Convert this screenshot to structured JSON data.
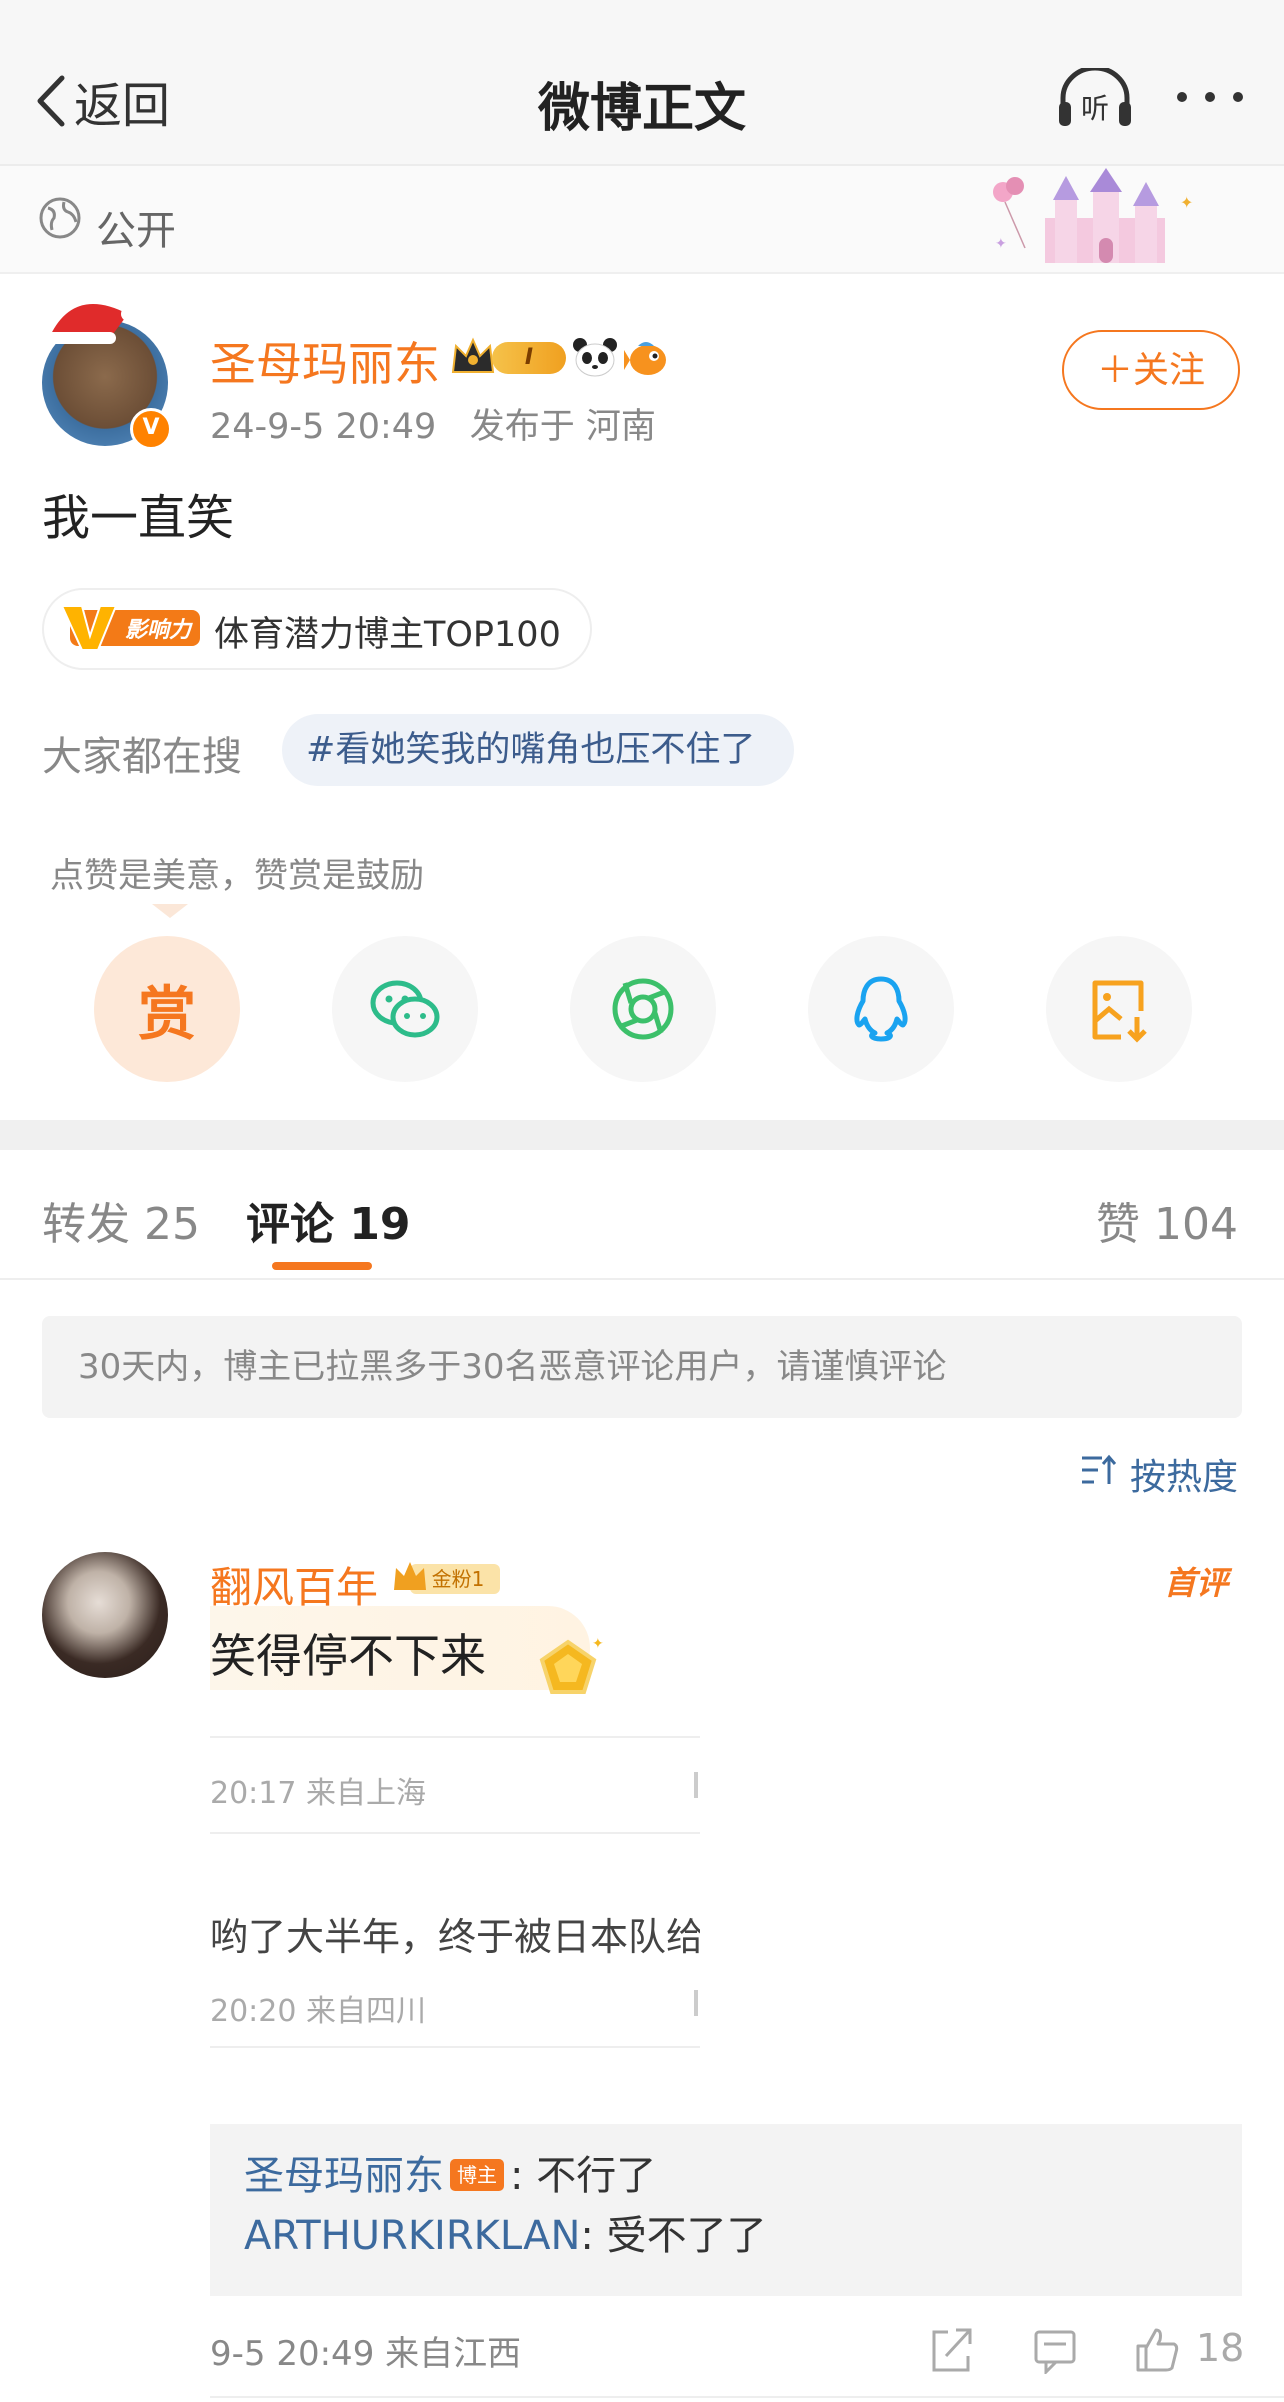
{
  "nav": {
    "back_label": "返回",
    "title": "微博正文",
    "listen_label": "听"
  },
  "visibility": {
    "label": "公开"
  },
  "post": {
    "author": "圣母玛丽东",
    "verified_mark": "V",
    "level": "I",
    "time": "24-9-5 20:49",
    "location": "发布于 河南",
    "follow_label": "＋关注",
    "text": "我一直笑",
    "influence_tag": "体育潜力博主TOP100",
    "influence_badge": "影响力",
    "search_label": "大家都在搜",
    "hot_topic": "#看她笑我的嘴角也压不住了"
  },
  "reward": {
    "hint": "点赞是美意，赞赏是鼓励",
    "button_label": "赏"
  },
  "tabs": [
    {
      "label": "转发 25"
    },
    {
      "label": "评论 19"
    },
    {
      "label": "赞 104"
    }
  ],
  "notice": "30天内，博主已拉黑多于30名恶意评论用户，请谨慎评论",
  "sort": {
    "label": "按热度"
  },
  "comment": {
    "author": "翻风百年",
    "fan_badge": "金粉1",
    "first_badge": "首评",
    "text": "笑得停不下来",
    "ghost_1_meta": "20:17  来自上海",
    "ghost_2_text": "哟了大半年，终于被日本队给",
    "ghost_2_meta": "20:20  来自四川",
    "replies": [
      {
        "user": "圣母玛丽东",
        "badge": "博主",
        "text": ": 不行了"
      },
      {
        "user": "ARTHURKIRKLAN",
        "text": ": 受不了了"
      }
    ],
    "meta": "9-5 20:49  来自江西",
    "likes": "18"
  },
  "colors": {
    "accent": "#f5771f",
    "link": "#3c6a9e"
  }
}
